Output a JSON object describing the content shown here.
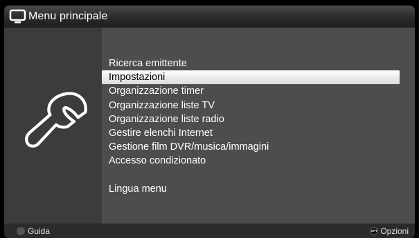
{
  "header": {
    "title": "Menu principale",
    "icon": "tv-icon"
  },
  "sidebar": {
    "icon": "wrench-icon"
  },
  "menu": {
    "selected_index": 1,
    "items": [
      "Ricerca emittente",
      "Impostazioni",
      "Organizzazione timer",
      "Organizzazione liste TV",
      "Organizzazione liste radio",
      "Gestire elenchi Internet",
      "Gestione film DVR/musica/immagini",
      "Accesso condizionato"
    ],
    "extra_items": [
      "Lingua menu"
    ]
  },
  "footer": {
    "left_label": "Guida",
    "right_badge": "OPT",
    "right_label": "Opzioni"
  },
  "colors": {
    "background": "#000000",
    "panel": "#4d4d4d",
    "sidebar": "#3c3c3c",
    "highlight": "#ffffff"
  }
}
